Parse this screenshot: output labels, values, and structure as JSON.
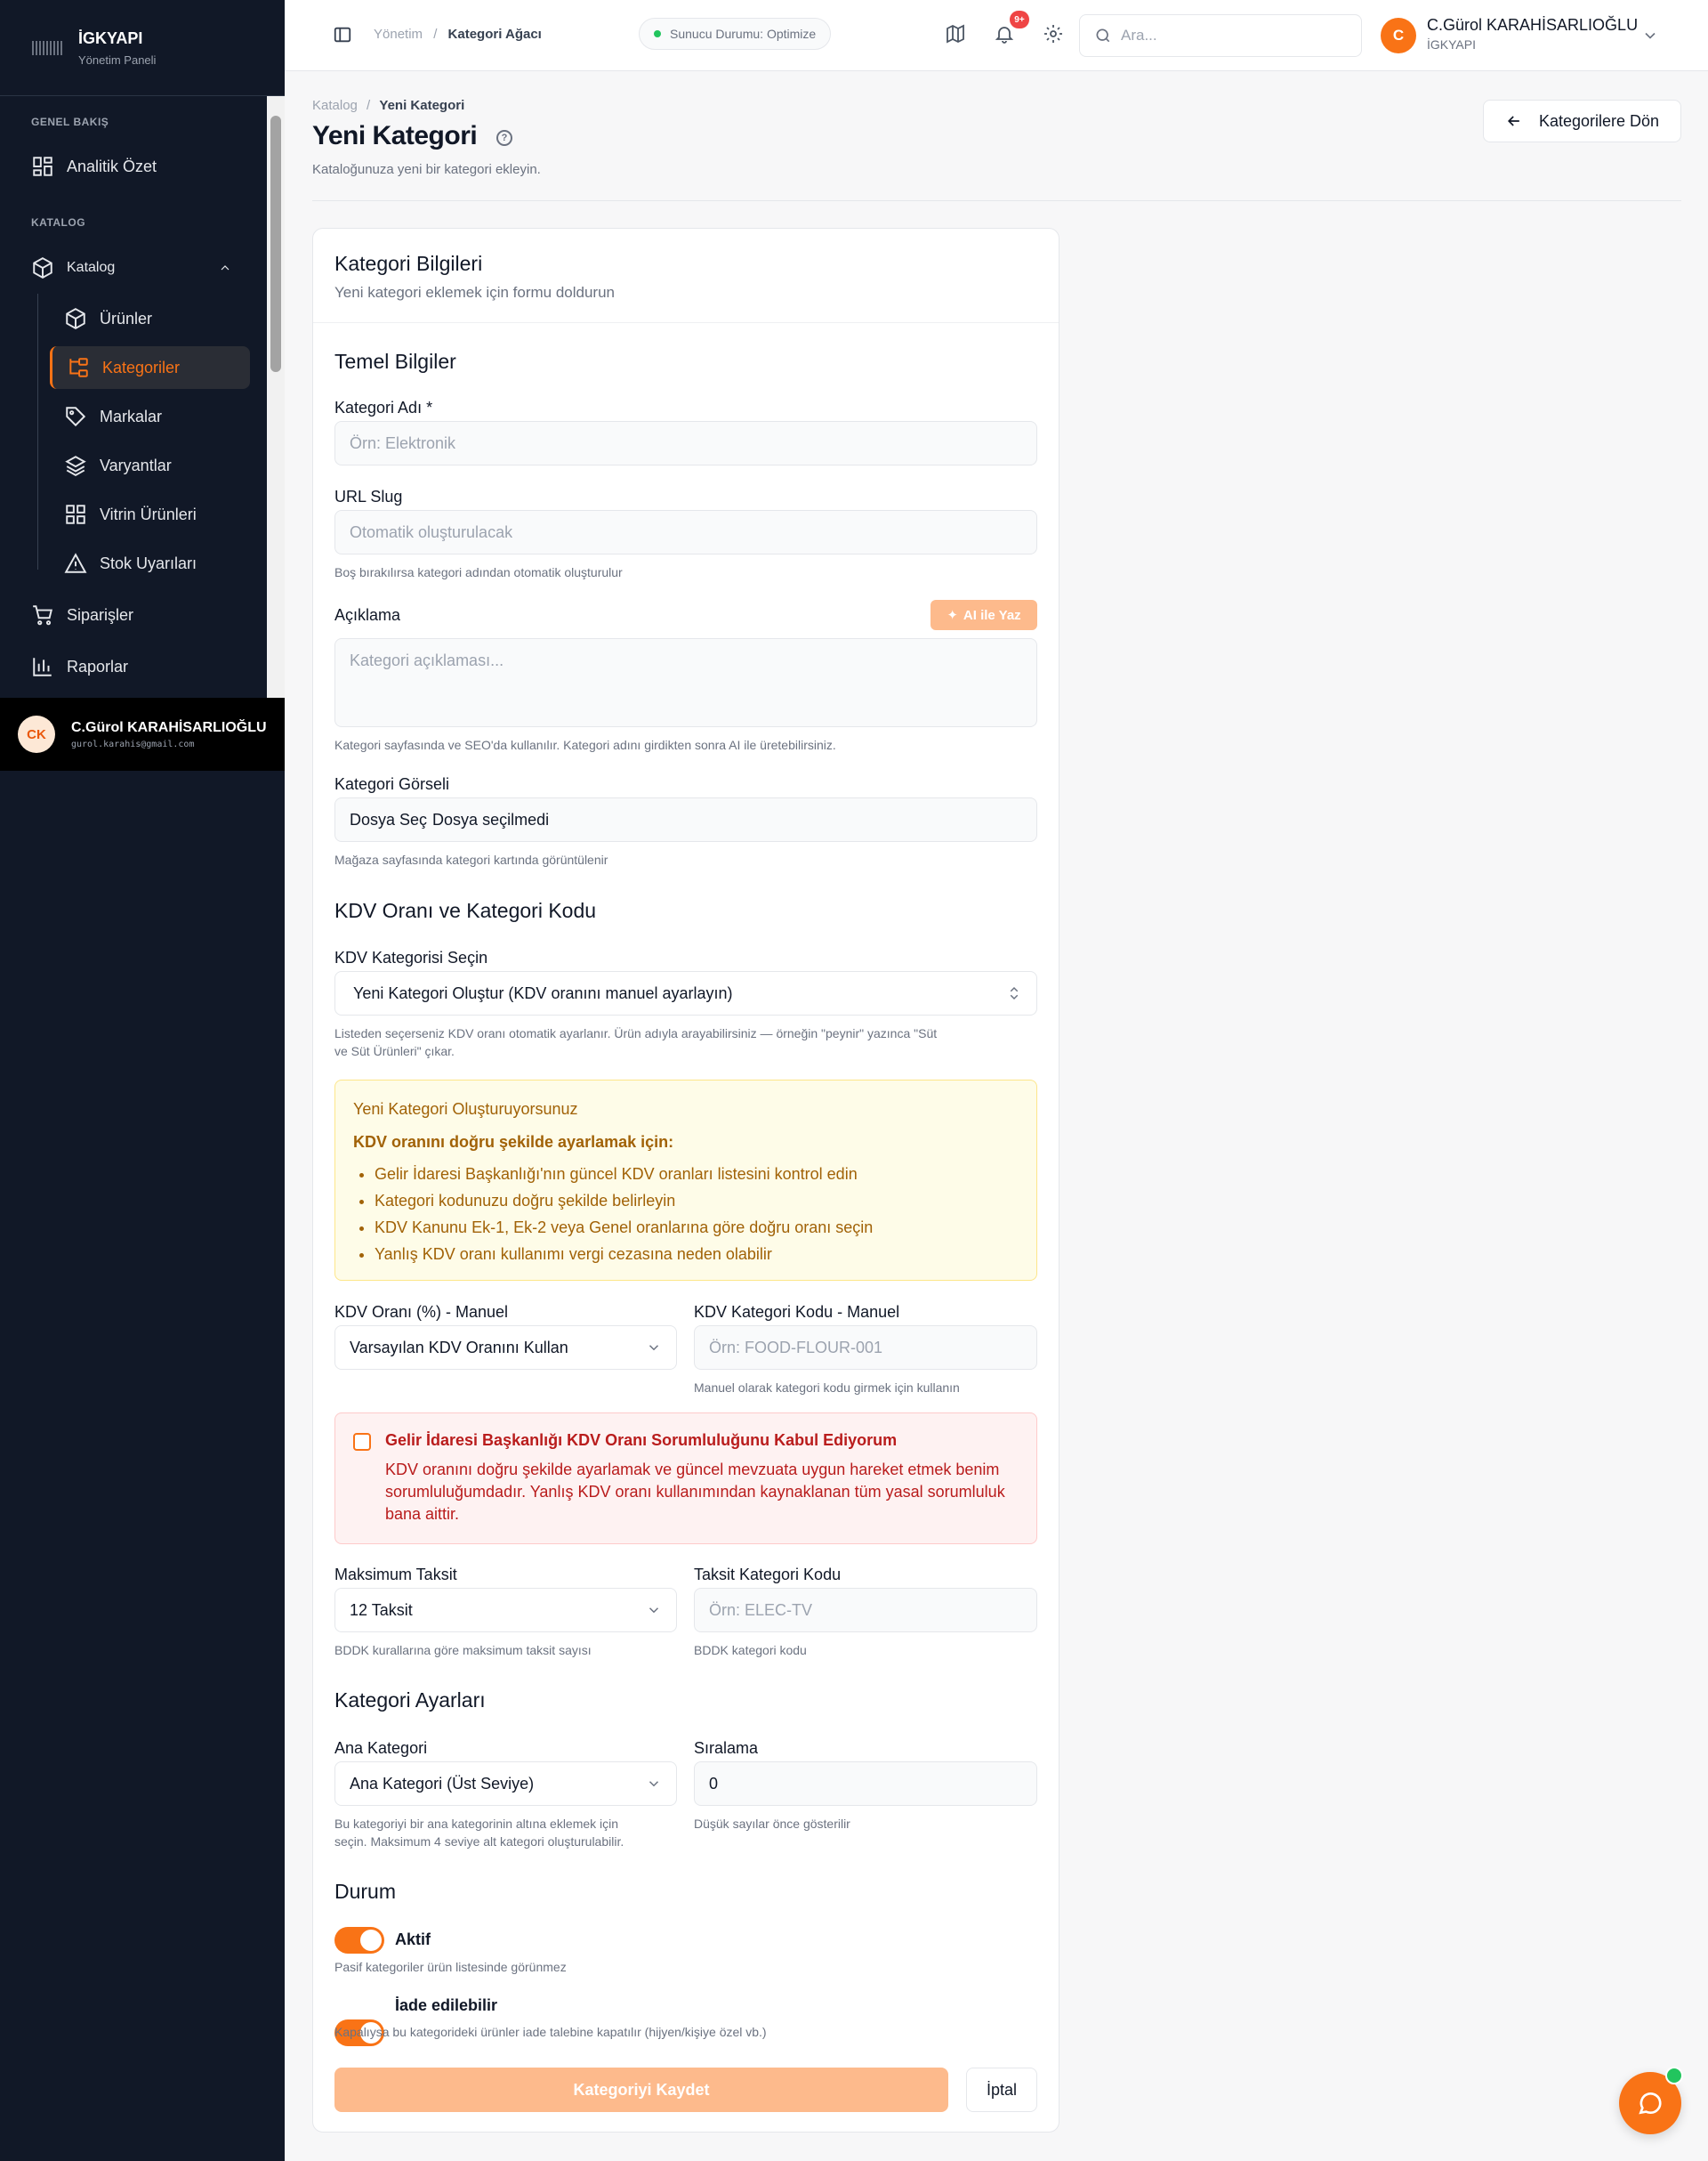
{
  "sidebar": {
    "brand_name": "İGKYAPI",
    "brand_sub": "Yönetim Paneli",
    "section_overview": "GENEL BAKIŞ",
    "item_analytics": "Analitik Özet",
    "section_catalog": "KATALOG",
    "item_catalog": "Katalog",
    "sub_items": [
      "Ürünler",
      "Kategoriler",
      "Markalar",
      "Varyantlar",
      "Vitrin Ürünleri",
      "Stok Uyarıları"
    ],
    "item_orders": "Siparişler",
    "item_reports": "Raporlar",
    "user_initials": "CK",
    "user_name": "C.Gürol KARAHİSARLIOĞLU",
    "user_email": "gurol.karahis@gmail.com"
  },
  "topbar": {
    "bc_root": "Yönetim",
    "bc_sep": "/",
    "bc_current": "Kategori Ağacı",
    "status": "Sunucu Durumu: Optimize",
    "badge": "9+",
    "search_placeholder": "Ara...",
    "avatar_initial": "C",
    "user_name": "C.Gürol KARAHİSARLIOĞLU",
    "user_company": "İGKYAPI"
  },
  "page": {
    "bc_root": "Katalog",
    "bc_sep": "/",
    "bc_current": "Yeni Kategori",
    "title": "Yeni Kategori",
    "help": "?",
    "subtitle": "Kataloğunuza yeni bir kategori ekleyin.",
    "back_label": "Kategorilere Dön"
  },
  "form": {
    "card_title": "Kategori Bilgileri",
    "card_sub": "Yeni kategori eklemek için formu doldurun",
    "sec_basic": "Temel Bilgiler",
    "name_label": "Kategori Adı *",
    "name_placeholder": "Örn: Elektronik",
    "slug_label": "URL Slug",
    "slug_placeholder": "Otomatik oluşturulacak",
    "slug_hint": "Boş bırakılırsa kategori adından otomatik oluşturulur",
    "desc_label": "Açıklama",
    "ai_label": "AI ile Yaz",
    "desc_placeholder": "Kategori açıklaması...",
    "desc_hint": "Kategori sayfasında ve SEO'da kullanılır. Kategori adını girdikten sonra AI ile üretebilirsiniz.",
    "image_label": "Kategori Görseli",
    "file_button": "Dosya Seç",
    "file_status": "Dosya seçilmedi",
    "image_hint": "Mağaza sayfasında kategori kartında görüntülenir",
    "sec_kdv": "KDV Oranı ve Kategori Kodu",
    "kdv_select_label": "KDV Kategorisi Seçin",
    "kdv_select_value": "Yeni Kategori Oluştur (KDV oranını manuel ayarlayın)",
    "kdv_select_hint_1": "Listeden seçerseniz KDV oranı otomatik ayarlanır. Ürün adıyla arayabilirsiniz — örneğin \"peynir\" yazınca \"Süt",
    "kdv_select_hint_2": "ve Süt Ürünleri\" çıkar.",
    "warn_title": "Yeni Kategori Oluşturuyorsunuz",
    "warn_strong": "KDV oranını doğru şekilde ayarlamak için:",
    "warn_items": [
      "Gelir İdaresi Başkanlığı'nın güncel KDV oranları listesini kontrol edin",
      "Kategori kodunuzu doğru şekilde belirleyin",
      "KDV Kanunu Ek-1, Ek-2 veya Genel oranlarına göre doğru oranı seçin",
      "Yanlış KDV oranı kullanımı vergi cezasına neden olabilir"
    ],
    "kdv_rate_label": "KDV Oranı (%) - Manuel",
    "kdv_rate_value": "Varsayılan KDV Oranını Kullan",
    "kdv_code_label": "KDV Kategori Kodu - Manuel",
    "kdv_code_placeholder": "Örn: FOOD-FLOUR-001",
    "kdv_code_hint": "Manuel olarak kategori kodu girmek için kullanın",
    "danger_title": "Gelir İdaresi Başkanlığı KDV Oranı Sorumluluğunu Kabul Ediyorum",
    "danger_text": "KDV oranını doğru şekilde ayarlamak ve güncel mevzuata uygun hareket etmek benim sorumluluğumdadır. Yanlış KDV oranı kullanımından kaynaklanan tüm yasal sorumluluk bana aittir.",
    "installment_label": "Maksimum Taksit",
    "installment_value": "12 Taksit",
    "installment_hint": "BDDK kurallarına göre maksimum taksit sayısı",
    "inst_code_label": "Taksit Kategori Kodu",
    "inst_code_placeholder": "Örn: ELEC-TV",
    "inst_code_hint": "BDDK kategori kodu",
    "sec_settings": "Kategori Ayarları",
    "parent_label": "Ana Kategori",
    "parent_value": "Ana Kategori (Üst Seviye)",
    "parent_hint_1": "Bu kategoriyi bir ana kategorinin altına eklemek için",
    "parent_hint_2": "seçin. Maksimum 4 seviye alt kategori oluşturulabilir.",
    "order_label": "Sıralama",
    "order_value": "0",
    "order_hint": "Düşük sayılar önce gösterilir",
    "sec_status": "Durum",
    "active_label": "Aktif",
    "active_hint": "Pasif kategoriler ürün listesinde görünmez",
    "return_label": "İade edilebilir",
    "return_hint": "Kapalıysa bu kategorideki ürünler iade talebine kapatılır (hijyen/kişiye özel vb.)",
    "save_label": "Kategoriyi Kaydet",
    "cancel_label": "İptal"
  },
  "colors": {
    "accent": "#f97316",
    "sidebar_bg": "#111827",
    "warning_bg": "#fefce8",
    "danger_bg": "#fef2f2"
  }
}
